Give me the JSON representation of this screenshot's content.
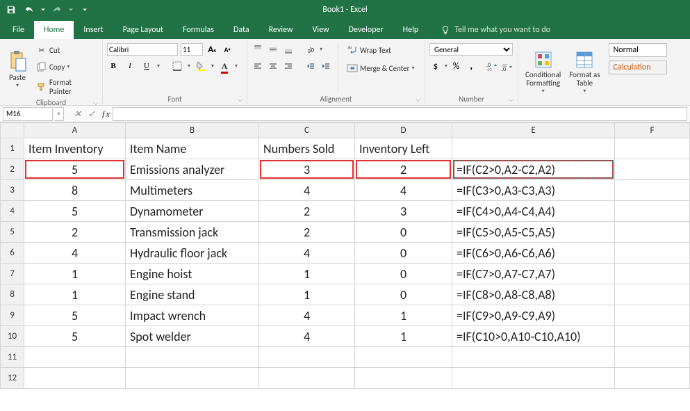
{
  "app": {
    "title": "Book1 - Excel"
  },
  "tabs": {
    "file": "File",
    "home": "Home",
    "insert": "Insert",
    "pageLayout": "Page Layout",
    "formulas": "Formulas",
    "data": "Data",
    "review": "Review",
    "view": "View",
    "developer": "Developer",
    "help": "Help",
    "tell": "Tell me what you want to do"
  },
  "ribbon": {
    "clipboard": {
      "paste": "Paste",
      "cut": "Cut",
      "copy": "Copy",
      "formatPainter": "Format Painter",
      "label": "Clipboard"
    },
    "font": {
      "name": "Calibri",
      "size": "11",
      "label": "Font"
    },
    "alignment": {
      "wrap": "Wrap Text",
      "merge": "Merge & Center",
      "label": "Alignment"
    },
    "number": {
      "format": "General",
      "label": "Number"
    },
    "styles": {
      "cond": "Conditional\nFormatting",
      "table": "Format as\nTable",
      "normal": "Normal",
      "calculation": "Calculation"
    }
  },
  "fxbar": {
    "name": "M16",
    "formula": ""
  },
  "columns": [
    "A",
    "B",
    "C",
    "D",
    "E",
    "F"
  ],
  "rowNumbers": [
    1,
    2,
    3,
    4,
    5,
    6,
    7,
    8,
    9,
    10,
    11,
    12
  ],
  "headerRow": {
    "A": "Item Inventory",
    "B": "Item Name",
    "C": "Numbers Sold",
    "D": "Inventory Left"
  },
  "dataRows": [
    {
      "A": "5",
      "B": "Emissions analyzer",
      "C": "3",
      "D": "2",
      "E": "=IF(C2>0,A2-C2,A2)"
    },
    {
      "A": "8",
      "B": "Multimeters",
      "C": "4",
      "D": "4",
      "E": "=IF(C3>0,A3-C3,A3)"
    },
    {
      "A": "5",
      "B": "Dynamometer",
      "C": "2",
      "D": "3",
      "E": "=IF(C4>0,A4-C4,A4)"
    },
    {
      "A": "2",
      "B": "Transmission jack",
      "C": "2",
      "D": "0",
      "E": "=IF(C5>0,A5-C5,A5)"
    },
    {
      "A": "4",
      "B": "Hydraulic floor jack",
      "C": "4",
      "D": "0",
      "E": "=IF(C6>0,A6-C6,A6)"
    },
    {
      "A": "1",
      "B": "Engine hoist",
      "C": "1",
      "D": "0",
      "E": "=IF(C7>0,A7-C7,A7)"
    },
    {
      "A": "1",
      "B": "Engine stand",
      "C": "1",
      "D": "0",
      "E": "=IF(C8>0,A8-C8,A8)"
    },
    {
      "A": "5",
      "B": "Impact wrench",
      "C": "4",
      "D": "1",
      "E": "=IF(C9>0,A9-C9,A9)"
    },
    {
      "A": "5",
      "B": "Spot welder",
      "C": "4",
      "D": "1",
      "E": "=IF(C10>0,A10-C10,A10)"
    }
  ]
}
